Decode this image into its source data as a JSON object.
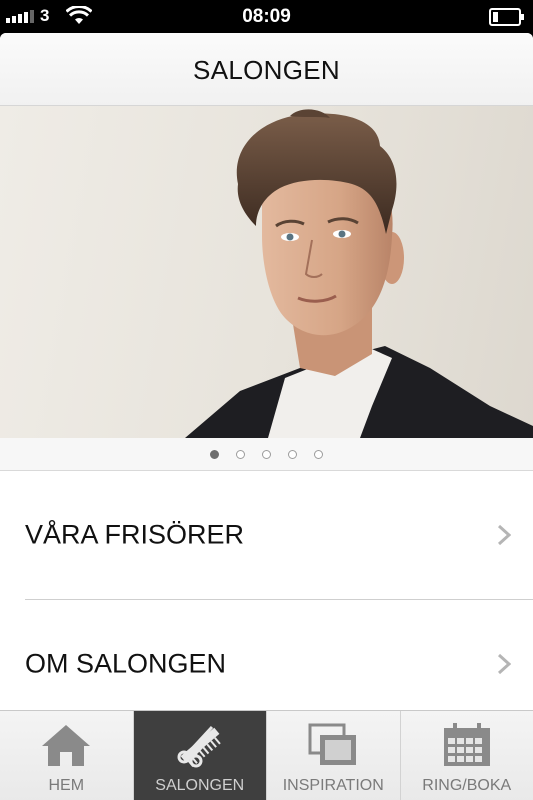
{
  "status": {
    "carrier": "3",
    "time": "08:09"
  },
  "nav": {
    "title": "SALONGEN"
  },
  "carousel": {
    "pages": 5,
    "active_index": 0
  },
  "menu": [
    {
      "label": "VÅRA FRISÖRER"
    },
    {
      "label": "OM SALONGEN"
    }
  ],
  "tabs": [
    {
      "label": "HEM",
      "icon": "home-icon",
      "active": false
    },
    {
      "label": "SALONGEN",
      "icon": "scissors-comb-icon",
      "active": true
    },
    {
      "label": "INSPIRATION",
      "icon": "gallery-icon",
      "active": false
    },
    {
      "label": "RING/BOKA",
      "icon": "calendar-icon",
      "active": false
    }
  ],
  "colors": {
    "active_tab": "#3f3f3f",
    "tab_text": "#7a7a7a",
    "chevron": "#b5b5b5"
  }
}
